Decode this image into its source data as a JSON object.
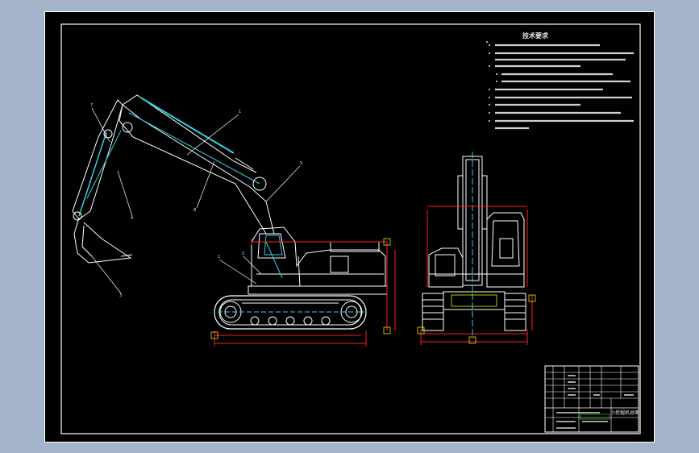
{
  "drawing": {
    "tech_title": "技术要求",
    "tb_name": "小挖掘机总图",
    "colors": {
      "paper": "#000000",
      "frame": "#ffffff",
      "outline": "#33d0e8",
      "dimension": "#ff2020",
      "marker": "#e6e600",
      "background": "#a3b3c9"
    }
  }
}
